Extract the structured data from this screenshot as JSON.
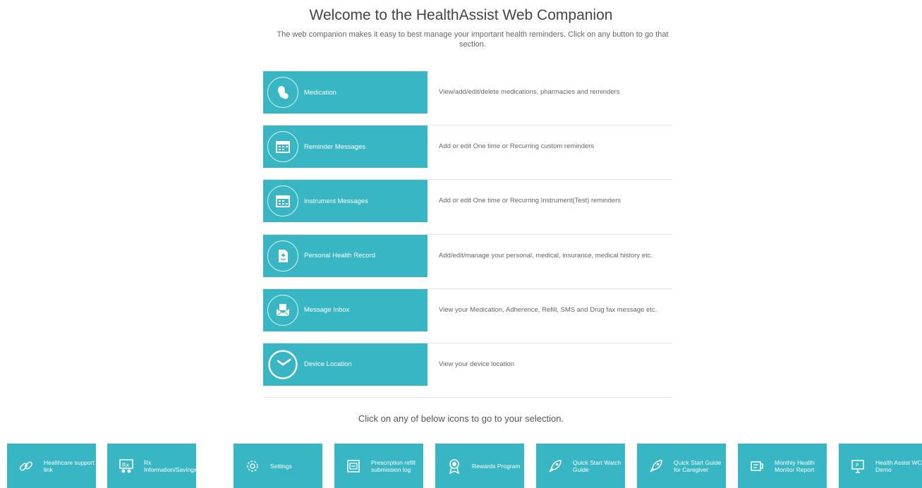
{
  "header": {
    "title": "Welcome to the HealthAssist Web Companion",
    "subtitle": "The web companion makes it easy to best manage your important health reminders. Click on any button to go that section."
  },
  "sections": [
    {
      "label": "Medication",
      "icon": "pill-icon",
      "description": "View/add/edit/delete medications, pharmacies and reminders"
    },
    {
      "label": "Reminder Messages",
      "icon": "calendar-icon",
      "description": "Add or edit One time or Recurring custom reminders"
    },
    {
      "label": "Instrument Messages",
      "icon": "instrument-calendar-icon",
      "description": "Add or edit One time or Recurring Instrument(Test) reminders"
    },
    {
      "label": "Personal Health Record",
      "icon": "health-record-icon",
      "description": "Add/edit/manage your personal, medical, insurance, medical history etc."
    },
    {
      "label": "Message Inbox",
      "icon": "envelope-icon",
      "description": "View your Medication, Adherence, Refill, SMS and Drug fax message etc."
    },
    {
      "label": "Device Location",
      "icon": "clock-icon",
      "description": "View your device location"
    }
  ],
  "icons_heading": "Click on any of below icons to go to your selection.",
  "tiles": [
    {
      "label": "Healthcare support link",
      "icon": "link-icon"
    },
    {
      "label": "Rx Information/Savings",
      "icon": "rx-icon"
    },
    {
      "label": "Settings",
      "icon": "gear-icon"
    },
    {
      "label": "Prescription refill submission log",
      "icon": "refill-log-icon"
    },
    {
      "label": "Rewards Program",
      "icon": "award-icon"
    },
    {
      "label": "Quick Start Watch Guide",
      "icon": "rocket-icon"
    },
    {
      "label": "Quick Start Guide for Caregiver",
      "icon": "rocket-icon"
    },
    {
      "label": "Monthly Health Monitor Report",
      "icon": "report-icon"
    },
    {
      "label": "Health Assist WC Demo",
      "icon": "presentation-icon"
    }
  ],
  "colors": {
    "accent": "#38b6c3",
    "text": "#555555"
  }
}
